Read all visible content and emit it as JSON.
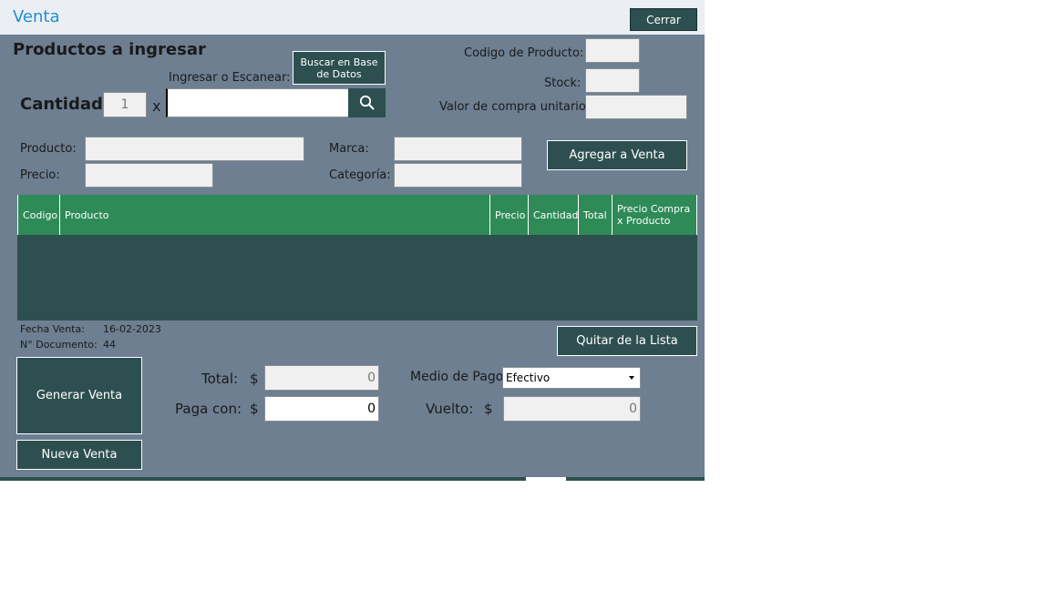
{
  "window": {
    "title": "Venta",
    "close_label": "Cerrar"
  },
  "header": {
    "section_title": "Productos a ingresar",
    "scan_label": "Ingresar o Escanear:",
    "search_db_label": "Buscar en Base de Datos",
    "quantity_label": "Cantidad:",
    "quantity_value": "1",
    "times_label": "x",
    "scan_value": ""
  },
  "product_info": {
    "code_label": "Codigo de Producto:",
    "code_value": "",
    "stock_label": "Stock:",
    "stock_value": "",
    "unit_cost_label": "Valor de compra unitario:",
    "unit_cost_value": "",
    "product_label": "Producto:",
    "product_value": "",
    "price_label": "Precio:",
    "price_value": "",
    "brand_label": "Marca:",
    "brand_value": "",
    "category_label": "Categoría:",
    "category_value": "",
    "add_label": "Agregar a Venta"
  },
  "table": {
    "columns": [
      "Codigo",
      "Producto",
      "Precio",
      "Cantidad",
      "Total",
      "Precio Compra x Producto"
    ],
    "rows": []
  },
  "sale_info": {
    "date_label": "Fecha Venta:",
    "date_value": "16-02-2023",
    "doc_label": "N° Documento:",
    "doc_value": "44",
    "remove_label": "Quitar de la Lista"
  },
  "actions": {
    "generate_label": "Generar Venta",
    "new_label": "Nueva Venta"
  },
  "totals": {
    "total_label": "Total:",
    "currency": "$",
    "total_value": "0",
    "pay_label": "Paga con:",
    "pay_value": "0",
    "payment_method_label": "Medio de Pago",
    "payment_method_value": "Efectivo",
    "change_label": "Vuelto:",
    "change_value": "0"
  },
  "icons": {
    "search": "magnifier-icon",
    "dropdown": "caret-down-icon"
  },
  "colors": {
    "background": "#6d7f91",
    "titlebar": "#ebeef3",
    "title_text": "#1e8fd6",
    "dark_button": "#2e4f4f",
    "grid_header": "#2e8b57",
    "grid_body": "#2e4f4f"
  }
}
